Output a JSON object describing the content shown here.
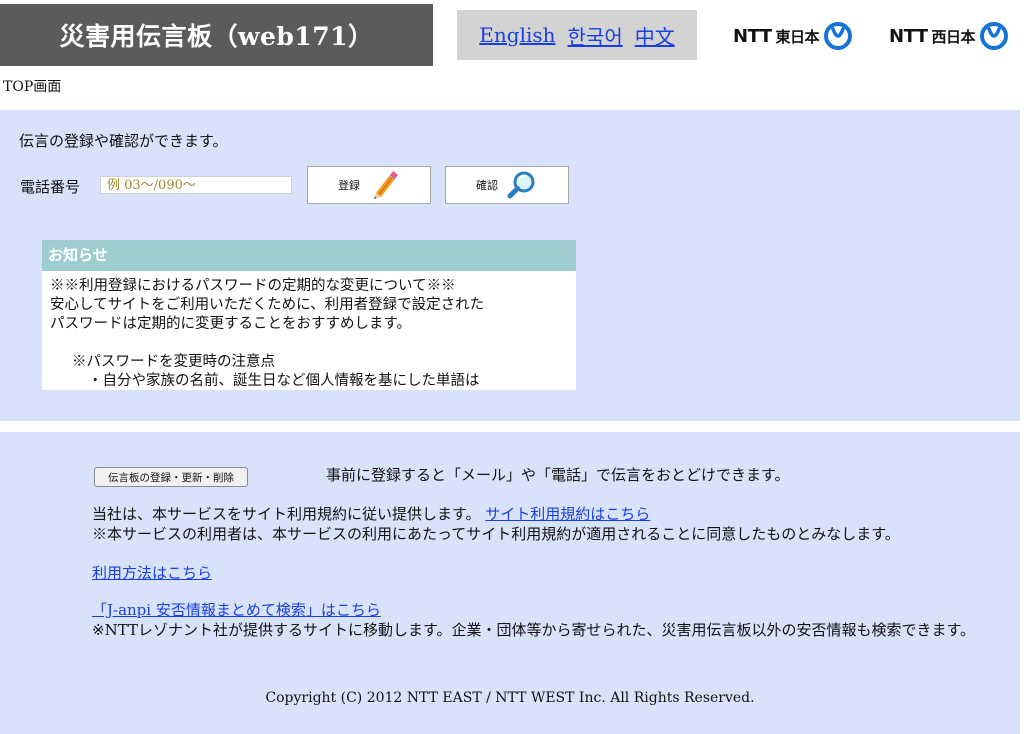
{
  "header": {
    "title": "災害用伝言板（web171）",
    "languages": [
      "English",
      "한국어",
      "中文"
    ],
    "ntt_east": {
      "mark": "NTT",
      "region": "東日本"
    },
    "ntt_west": {
      "mark": "NTT",
      "region": "西日本"
    }
  },
  "page_label": "TOP画面",
  "main": {
    "intro": "伝言の登録や確認ができます。",
    "phone_label": "電話番号",
    "phone_placeholder": "例 03～/090～",
    "register_label": "登録",
    "confirm_label": "確認"
  },
  "notice": {
    "header": "お知らせ",
    "lines": [
      "※※利用登録におけるパスワードの定期的な変更について※※",
      "安心してサイトをご利用いただくために、利用者登録で設定された",
      "パスワードは定期的に変更することをおすすめします。",
      "",
      "※パスワードを変更時の注意点",
      "・自分や家族の名前、誕生日など個人情報を基にした単語は"
    ]
  },
  "info": {
    "manage_button": "伝言板の登録・更新・削除",
    "manage_desc": "事前に登録すると「メール」や「電話」で伝言をおとどけできます。",
    "terms_text": "当社は、本サービスをサイト利用規約に従い提供します。",
    "terms_link": "サイト利用規約はこちら",
    "terms_note": "※本サービスの利用者は、本サービスの利用にあたってサイト利用規約が適用されることに同意したものとみなします。",
    "howto_link": "利用方法はこちら",
    "janpi_link": "「J-anpi 安否情報まとめて検索」はこちら",
    "janpi_note": "※NTTレゾナント社が提供するサイトに移動します。企業・団体等から寄せられた、災害用伝言板以外の安否情報も検索できます。"
  },
  "copyright": "Copyright (C) 2012 NTT EAST / NTT WEST Inc. All Rights Reserved.",
  "colors": {
    "title_bg": "#5b5b5b",
    "lang_bg": "#d3d3d3",
    "panel_bg": "#d8e3fb",
    "notice_header_bg": "#9ecdd0",
    "link": "#1a3fe0",
    "ntt_logo": "#1673d6"
  },
  "icons": {
    "register": "pencil-icon",
    "confirm": "magnifier-icon",
    "ntt_east_logo": "ntt-logo-icon",
    "ntt_west_logo": "ntt-logo-icon"
  }
}
